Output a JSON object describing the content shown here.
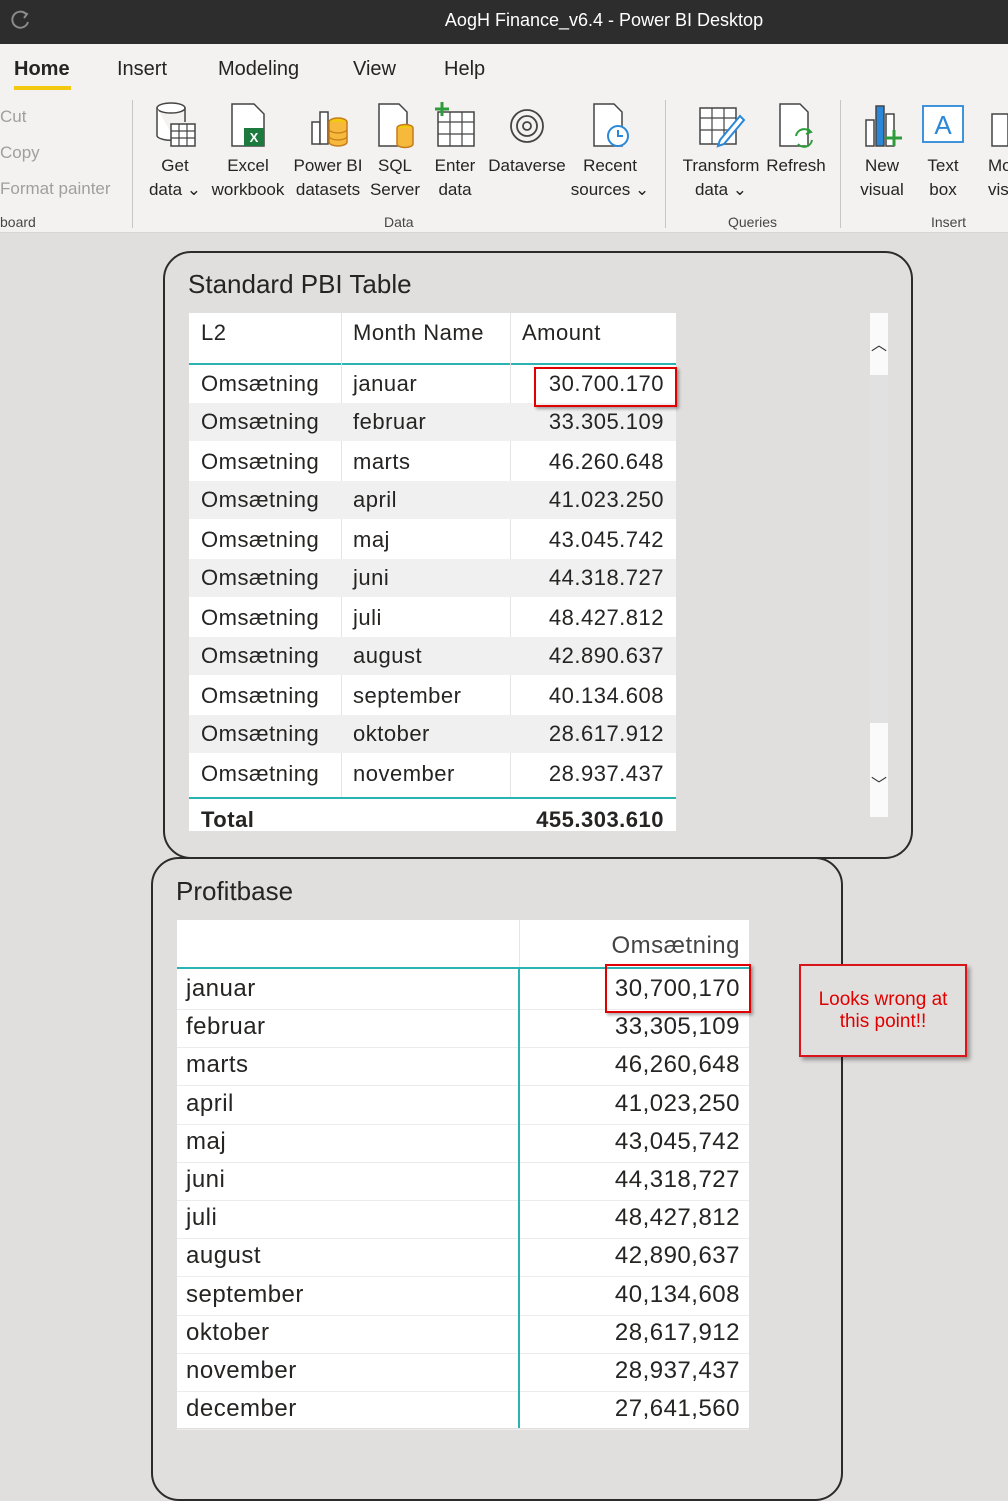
{
  "window": {
    "title": "AogH Finance_v6.4 - Power BI Desktop"
  },
  "tabs": [
    "Home",
    "Insert",
    "Modeling",
    "View",
    "Help"
  ],
  "clipboard": {
    "cut": "Cut",
    "copy": "Copy",
    "format_painter": "Format painter",
    "group": "board"
  },
  "data_group": {
    "label": "Data",
    "buttons": [
      {
        "label": "Get\ndata ⌄",
        "icon": "database-table-icon"
      },
      {
        "label": "Excel\nworkbook",
        "icon": "excel-icon"
      },
      {
        "label": "Power BI\ndatasets",
        "icon": "powerbi-datasets-icon"
      },
      {
        "label": "SQL\nServer",
        "icon": "sql-server-icon"
      },
      {
        "label": "Enter\ndata",
        "icon": "enter-data-icon"
      },
      {
        "label": "Dataverse",
        "icon": "dataverse-icon"
      },
      {
        "label": "Recent\nsources ⌄",
        "icon": "recent-sources-icon"
      }
    ]
  },
  "queries_group": {
    "label": "Queries",
    "buttons": [
      {
        "label": "Transform\ndata ⌄",
        "icon": "transform-data-icon"
      },
      {
        "label": "Refresh",
        "icon": "refresh-icon"
      }
    ]
  },
  "insert_group": {
    "label": "Insert",
    "buttons": [
      {
        "label": "New\nvisual",
        "icon": "new-visual-icon"
      },
      {
        "label": "Text\nbox",
        "icon": "text-box-icon"
      },
      {
        "label": "Mo\nvisu",
        "icon": "more-visuals-icon"
      }
    ]
  },
  "standard_table": {
    "title": "Standard PBI Table",
    "headers": [
      "L2",
      "Month Name",
      "Amount"
    ],
    "rows": [
      [
        "Omsætning",
        "januar",
        "30.700.170"
      ],
      [
        "Omsætning",
        "februar",
        "33.305.109"
      ],
      [
        "Omsætning",
        "marts",
        "46.260.648"
      ],
      [
        "Omsætning",
        "april",
        "41.023.250"
      ],
      [
        "Omsætning",
        "maj",
        "43.045.742"
      ],
      [
        "Omsætning",
        "juni",
        "44.318.727"
      ],
      [
        "Omsætning",
        "juli",
        "48.427.812"
      ],
      [
        "Omsætning",
        "august",
        "42.890.637"
      ],
      [
        "Omsætning",
        "september",
        "40.134.608"
      ],
      [
        "Omsætning",
        "oktober",
        "28.617.912"
      ],
      [
        "Omsætning",
        "november",
        "28.937.437"
      ]
    ],
    "total_label": "Total",
    "total_value": "455.303.610"
  },
  "profitbase": {
    "title": "Profitbase",
    "column_header": "Omsætning",
    "rows": [
      [
        "januar",
        "30,700,170"
      ],
      [
        "februar",
        "33,305,109"
      ],
      [
        "marts",
        "46,260,648"
      ],
      [
        "april",
        "41,023,250"
      ],
      [
        "maj",
        "43,045,742"
      ],
      [
        "juni",
        "44,318,727"
      ],
      [
        "juli",
        "48,427,812"
      ],
      [
        "august",
        "42,890,637"
      ],
      [
        "september",
        "40,134,608"
      ],
      [
        "oktober",
        "28,617,912"
      ],
      [
        "november",
        "28,937,437"
      ],
      [
        "december",
        "27,641,560"
      ]
    ]
  },
  "annotation": {
    "note": "Looks wrong at this point!!"
  },
  "colors": {
    "accent_teal": "#2bb3b1",
    "highlight_red": "#e00000",
    "tab_underline": "#f2c811"
  }
}
